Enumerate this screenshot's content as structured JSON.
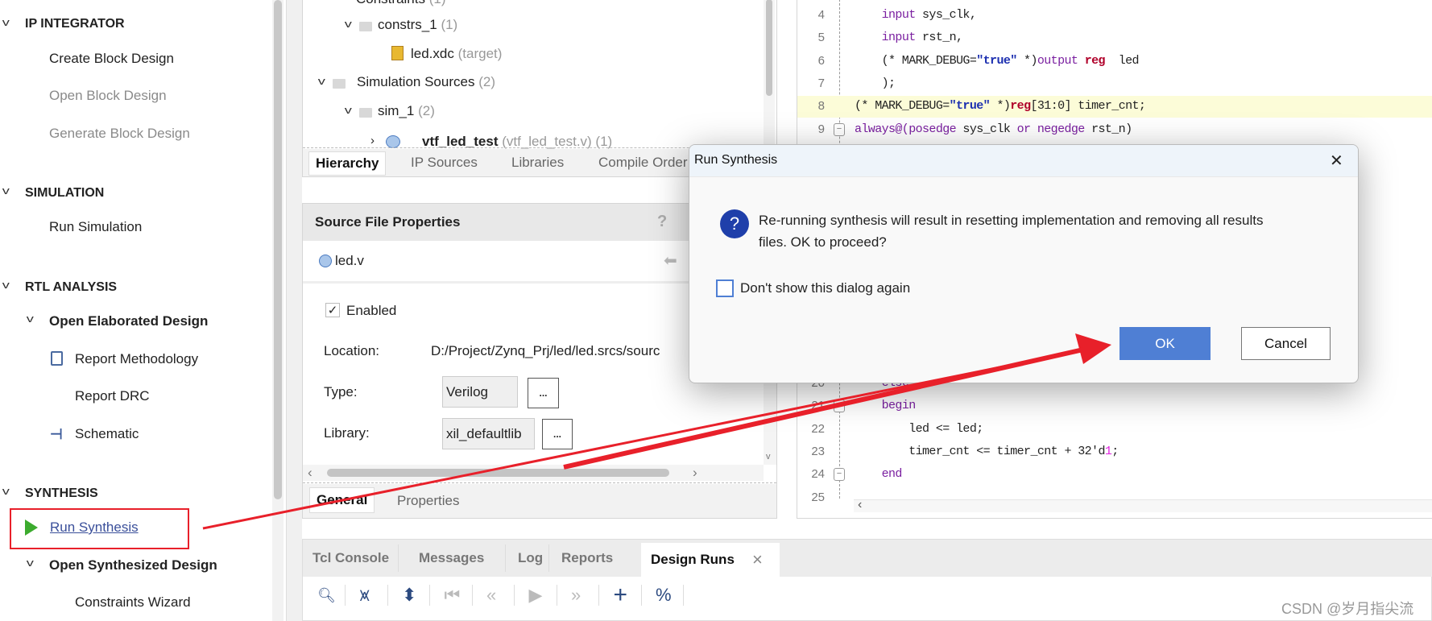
{
  "left_nav": {
    "ip_integrator": {
      "title": "IP INTEGRATOR",
      "items": [
        "Create Block Design",
        "Open Block Design",
        "Generate Block Design"
      ]
    },
    "simulation": {
      "title": "SIMULATION",
      "items": [
        "Run Simulation"
      ]
    },
    "rtl": {
      "title": "RTL ANALYSIS",
      "group": "Open Elaborated Design",
      "items": [
        "Report Methodology",
        "Report DRC",
        "Schematic"
      ]
    },
    "synthesis": {
      "title": "SYNTHESIS",
      "run": "Run Synthesis",
      "group": "Open Synthesized Design",
      "items": [
        "Constraints Wizard"
      ]
    }
  },
  "sources": {
    "tree": [
      {
        "label": "Constraints",
        "count": "(1)"
      },
      {
        "label": "constrs_1",
        "count": "(1)"
      },
      {
        "label": "led.xdc",
        "count": "(target)"
      },
      {
        "label": "Simulation Sources",
        "count": "(2)"
      },
      {
        "label": "sim_1",
        "count": "(2)"
      },
      {
        "label": "vtf_led_test",
        "count": "(vtf_led_test.v) (1)"
      }
    ],
    "tabs": [
      "Hierarchy",
      "IP Sources",
      "Libraries",
      "Compile Order"
    ],
    "active_tab": "Hierarchy"
  },
  "props": {
    "title": "Source File Properties",
    "help": "?",
    "file": "led.v",
    "enabled_label": "Enabled",
    "enabled": true,
    "location_label": "Location:",
    "location_value": "D:/Project/Zynq_Prj/led/led.srcs/sourc",
    "type_label": "Type:",
    "type_value": "Verilog",
    "library_label": "Library:",
    "library_value": "xil_defaultlib",
    "dots": "...",
    "tabs": [
      "General",
      "Properties"
    ]
  },
  "editor": {
    "top_lines": [
      {
        "n": "4",
        "tokens": [
          [
            "    ",
            ""
          ],
          [
            "input",
            "kw"
          ],
          [
            " sys_clk,",
            ""
          ]
        ]
      },
      {
        "n": "5",
        "tokens": [
          [
            "    ",
            ""
          ],
          [
            "input",
            "kw"
          ],
          [
            " rst_n,",
            ""
          ]
        ]
      },
      {
        "n": "6",
        "tokens": [
          [
            "    (* MARK_DEBUG=",
            ""
          ],
          [
            "\"true\"",
            "st"
          ],
          [
            " *)",
            ""
          ],
          [
            "output",
            "kw"
          ],
          [
            " ",
            ""
          ],
          [
            "reg",
            "rg"
          ],
          [
            "  led",
            ""
          ]
        ]
      },
      {
        "n": "7",
        "tokens": [
          [
            "    );",
            ""
          ]
        ]
      },
      {
        "n": "8",
        "tokens": [
          [
            "(* MARK_DEBUG=",
            ""
          ],
          [
            "\"true\"",
            "st"
          ],
          [
            " *)",
            ""
          ],
          [
            "reg",
            "rg"
          ],
          [
            "[31:0] timer_cnt;",
            ""
          ]
        ],
        "highlight": true
      },
      {
        "n": "9",
        "tokens": [
          [
            "always@(posedge",
            "kw"
          ],
          [
            " sys_clk ",
            ""
          ],
          [
            "or negedge",
            "kw"
          ],
          [
            " rst_n)",
            ""
          ]
        ],
        "fold": true
      }
    ],
    "bottom_lines": [
      {
        "n": "20",
        "tokens": [
          [
            "    ",
            ""
          ],
          [
            "else",
            "kw"
          ]
        ]
      },
      {
        "n": "21",
        "tokens": [
          [
            "    ",
            ""
          ],
          [
            "begin",
            "kw"
          ]
        ],
        "fold": true
      },
      {
        "n": "22",
        "tokens": [
          [
            "        led <= led;",
            ""
          ]
        ]
      },
      {
        "n": "23",
        "tokens": [
          [
            "        timer_cnt <= timer_cnt + 32'd",
            ""
          ],
          [
            "1",
            "nm"
          ],
          [
            ";",
            ""
          ]
        ]
      },
      {
        "n": "24",
        "tokens": [
          [
            "    ",
            ""
          ],
          [
            "end",
            "kw"
          ]
        ],
        "fold": true
      },
      {
        "n": "25",
        "tokens": []
      }
    ]
  },
  "bottom": {
    "tabs": [
      "Tcl Console",
      "Messages",
      "Log",
      "Reports",
      "Design Runs"
    ],
    "active_tab": "Design Runs",
    "close": "×",
    "toolbar": [
      "search-icon",
      "collapse-all-icon",
      "expand-all-icon",
      "first-icon",
      "previous-icon",
      "run-icon",
      "next-icon",
      "add-icon",
      "percent-icon"
    ]
  },
  "dialog": {
    "title": "Run Synthesis",
    "close": "✕",
    "message_line1": "Re-running synthesis will result in resetting implementation and removing all results",
    "message_line2": "files. OK to proceed?",
    "checkbox_label": "Don't show this dialog again",
    "checkbox_checked": false,
    "ok": "OK",
    "cancel": "Cancel"
  },
  "annotation_color": "#e8202a",
  "accent": "#4f7fd4",
  "watermark": "CSDN @岁月指尖流"
}
